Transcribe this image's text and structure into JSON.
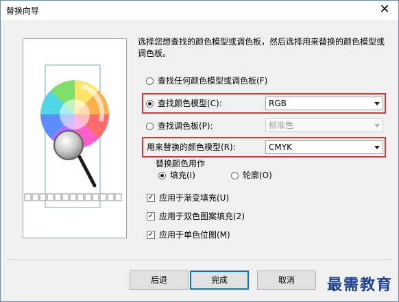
{
  "window": {
    "title": "替换向导",
    "close_glyph": "✕"
  },
  "description": "选择您想查找的颜色模型或调色板，然后选择用来替换的颜色模型或调色板。",
  "options": {
    "any_label": "查找任何颜色模型或调色板(F)",
    "model_label": "查找颜色模型(C):",
    "model_value": "RGB",
    "palette_label": "查找调色板(P):",
    "palette_value": "标准色",
    "replace_label": "用来替换的颜色模型(R):",
    "replace_value": "CMYK",
    "selected": "model"
  },
  "replace_group": {
    "label": "替换颜色用作",
    "fill_label": "填充(I)",
    "outline_label": "轮廓(O)",
    "selected": "fill"
  },
  "checkboxes": [
    {
      "label": "应用于渐变填充(U)",
      "checked": true
    },
    {
      "label": "应用于双色图案填充(2)",
      "checked": true
    },
    {
      "label": "应用于单色位图(M)",
      "checked": true
    }
  ],
  "buttons": {
    "back": "后退",
    "finish": "完成",
    "cancel": "取消"
  },
  "watermark": "最需教育",
  "colors": {
    "highlight": "#e0313a",
    "accent": "#0078d7"
  }
}
